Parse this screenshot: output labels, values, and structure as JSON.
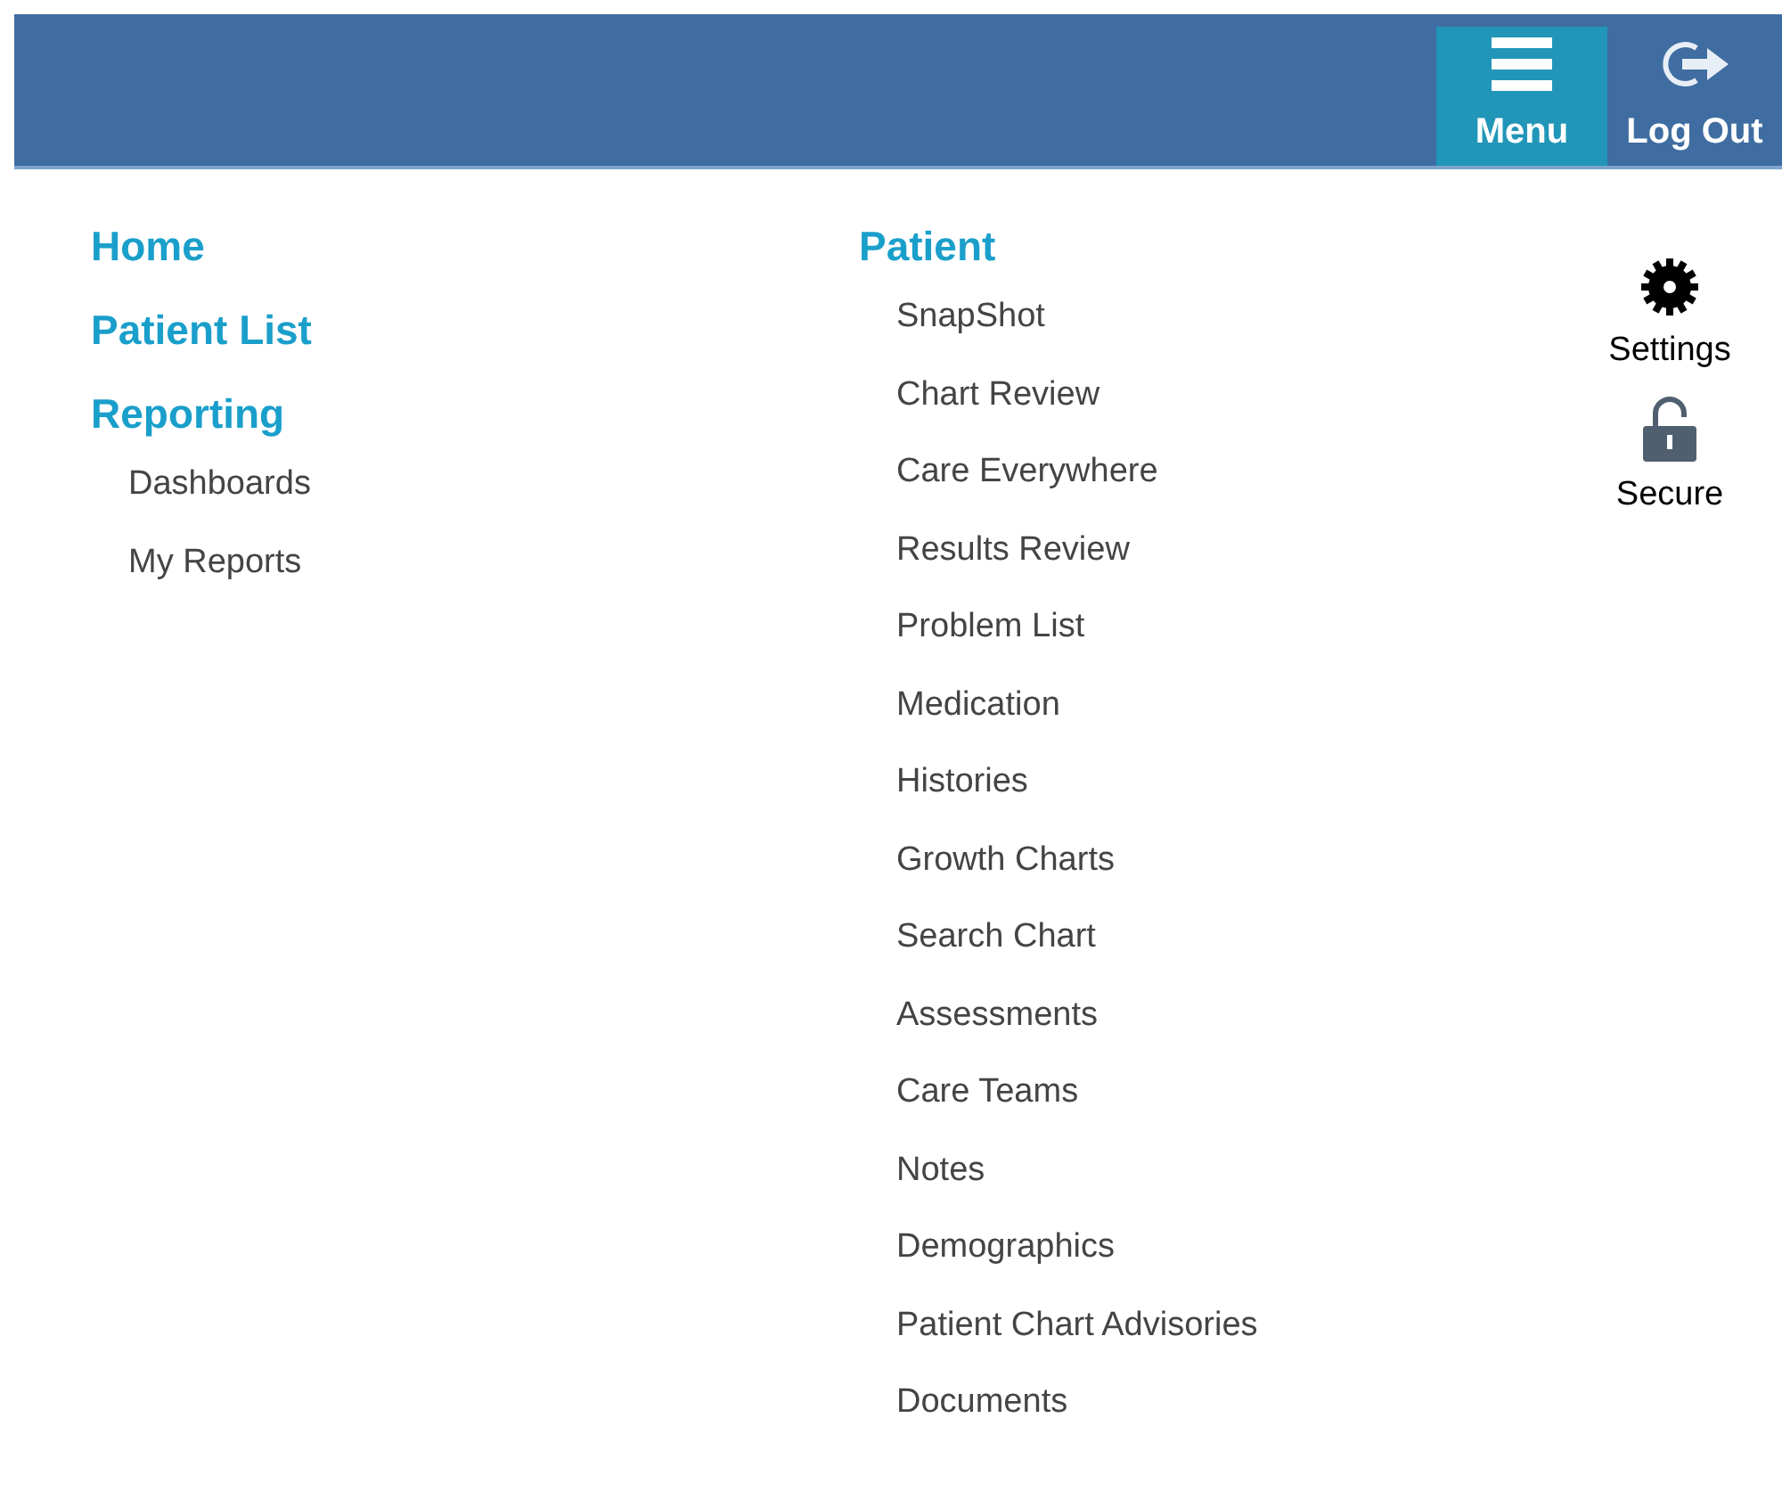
{
  "header": {
    "buttons": [
      {
        "kind": "menu",
        "label": "Menu",
        "selected": true
      },
      {
        "kind": "logout",
        "label": "Log Out",
        "selected": false
      }
    ]
  },
  "nav_columns": [
    {
      "sections": [
        {
          "label": "Home"
        },
        {
          "label": "Patient List"
        },
        {
          "label": "Reporting",
          "children": [
            "Dashboards",
            "My Reports"
          ]
        }
      ]
    },
    {
      "sections": [
        {
          "label": "Patient",
          "children": [
            "SnapShot",
            "Chart Review",
            "Care Everywhere",
            "Results Review",
            "Problem List",
            "Medication",
            "Histories",
            "Growth Charts",
            "Search Chart",
            "Assessments",
            "Care Teams",
            "Notes",
            "Demographics",
            "Patient Chart Advisories",
            "Documents"
          ]
        }
      ]
    }
  ],
  "side_actions": [
    {
      "kind": "settings",
      "label": "Settings"
    },
    {
      "kind": "secure",
      "label": "Secure"
    }
  ]
}
